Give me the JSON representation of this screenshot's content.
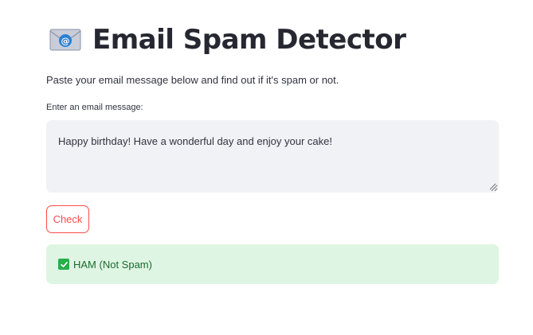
{
  "header": {
    "title": "Email Spam Detector",
    "icon": "email-envelope-icon"
  },
  "subtitle": "Paste your email message below and find out if it's spam or not.",
  "input": {
    "label": "Enter an email message:",
    "value": "Happy birthday! Have a wonderful day and enjoy your cake!"
  },
  "actions": {
    "check_label": "Check"
  },
  "result": {
    "icon": "check-mark-icon",
    "text": "HAM (Not Spam)",
    "status": "ham",
    "colors": {
      "background": "#dff5e3",
      "icon": "#22b14c",
      "text": "#1b6b2e"
    }
  },
  "theme": {
    "accent": "#ff4b4b",
    "input_background": "#f0f2f6"
  }
}
